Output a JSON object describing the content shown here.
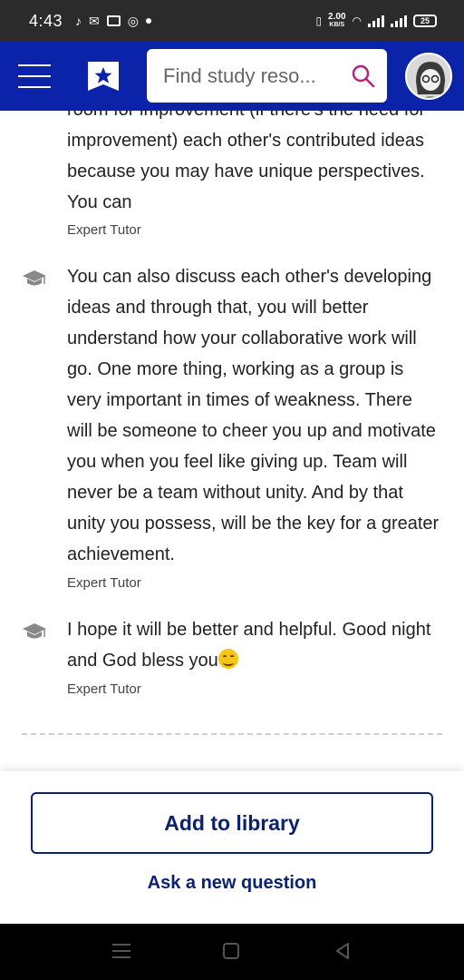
{
  "status_bar": {
    "time": "4:43",
    "speed_value": "2.00",
    "speed_unit": "KB/S",
    "battery": "25"
  },
  "header": {
    "search_placeholder": "Find study reso..."
  },
  "comments": [
    {
      "text": "room for improvement (if there's the need for improvement) each other's contributed ideas because you may have unique perspectives. You can",
      "author": "Expert Tutor"
    },
    {
      "text": "You can also discuss each other's developing ideas and through that, you will better understand how your collaborative work will go. One more thing, working as a group is very important in times of weakness. There will be someone to cheer you up and motivate you when you feel like giving up. Team will never be a team without unity. And by that unity you possess, will be the key for a greater achievement.",
      "author": "Expert Tutor"
    },
    {
      "text": "I hope it will be better and helpful. Good night and God bless you",
      "author": "Expert Tutor"
    }
  ],
  "actions": {
    "add_to_library": "Add to library",
    "ask_new_question": "Ask a new question"
  },
  "colors": {
    "header_bg": "#0a23a8",
    "accent_text": "#0b2270",
    "search_icon": "#b0267a"
  }
}
